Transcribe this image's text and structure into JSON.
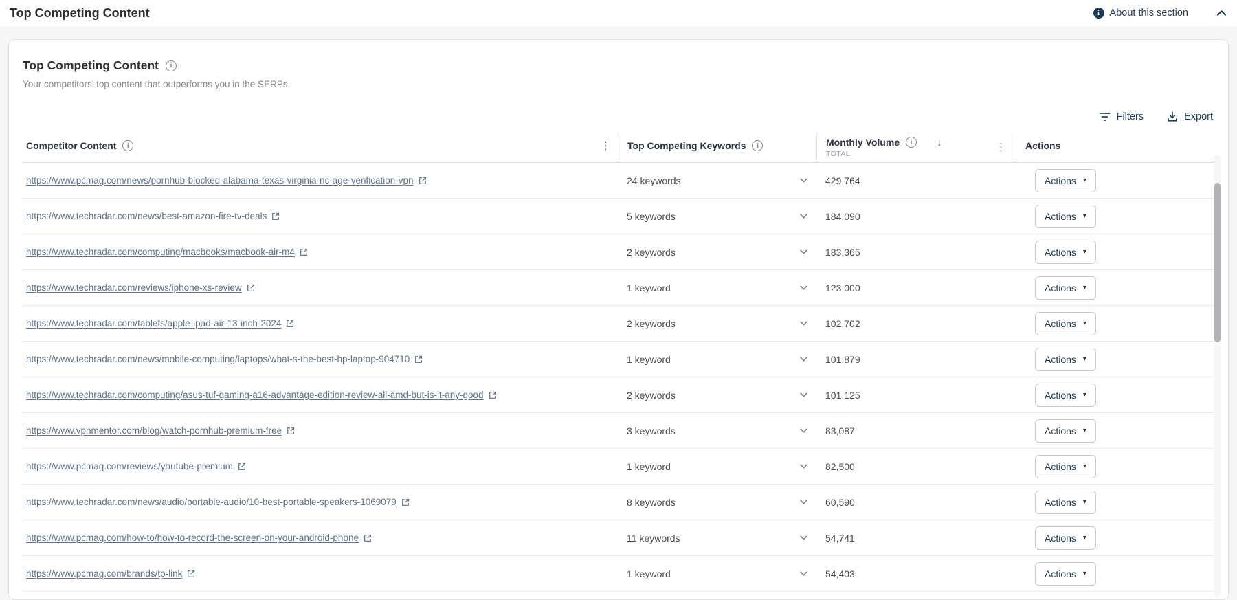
{
  "page": {
    "title": "Top Competing Content",
    "about_label": "About this section"
  },
  "card": {
    "title": "Top Competing Content",
    "subtitle": "Your competitors' top content that outperforms you in the SERPs.",
    "toolbar": {
      "filters_label": "Filters",
      "export_label": "Export"
    }
  },
  "table": {
    "columns": {
      "content": "Competitor Content",
      "keywords": "Top Competing Keywords",
      "volume": "Monthly Volume",
      "volume_sub": "TOTAL",
      "actions": "Actions"
    },
    "actions_label": "Actions",
    "rows": [
      {
        "url": "https://www.pcmag.com/news/pornhub-blocked-alabama-texas-virginia-nc-age-verification-vpn",
        "keywords": "24 keywords",
        "volume": "429,764"
      },
      {
        "url": "https://www.techradar.com/news/best-amazon-fire-tv-deals",
        "keywords": "5 keywords",
        "volume": "184,090"
      },
      {
        "url": "https://www.techradar.com/computing/macbooks/macbook-air-m4",
        "keywords": "2 keywords",
        "volume": "183,365"
      },
      {
        "url": "https://www.techradar.com/reviews/iphone-xs-review",
        "keywords": "1 keyword",
        "volume": "123,000"
      },
      {
        "url": "https://www.techradar.com/tablets/apple-ipad-air-13-inch-2024",
        "keywords": "2 keywords",
        "volume": "102,702"
      },
      {
        "url": "https://www.techradar.com/news/mobile-computing/laptops/what-s-the-best-hp-laptop-904710",
        "keywords": "1 keyword",
        "volume": "101,879"
      },
      {
        "url": "https://www.techradar.com/computing/asus-tuf-gaming-a16-advantage-edition-review-all-amd-but-is-it-any-good",
        "keywords": "2 keywords",
        "volume": "101,125"
      },
      {
        "url": "https://www.vpnmentor.com/blog/watch-pornhub-premium-free",
        "keywords": "3 keywords",
        "volume": "83,087"
      },
      {
        "url": "https://www.pcmag.com/reviews/youtube-premium",
        "keywords": "1 keyword",
        "volume": "82,500"
      },
      {
        "url": "https://www.techradar.com/news/audio/portable-audio/10-best-portable-speakers-1069079",
        "keywords": "8 keywords",
        "volume": "60,590"
      },
      {
        "url": "https://www.pcmag.com/how-to/how-to-record-the-screen-on-your-android-phone",
        "keywords": "11 keywords",
        "volume": "54,741"
      },
      {
        "url": "https://www.pcmag.com/brands/tp-link",
        "keywords": "1 keyword",
        "volume": "54,403"
      }
    ]
  },
  "icons": {
    "info": "i",
    "kebab": "⋮",
    "sort_desc": "↓",
    "caret_down": "▾"
  },
  "colors": {
    "accent_navy": "#1d3a57",
    "link": "#5f7389",
    "page_bg": "#f6f6f7",
    "border": "#e2e3e5"
  }
}
